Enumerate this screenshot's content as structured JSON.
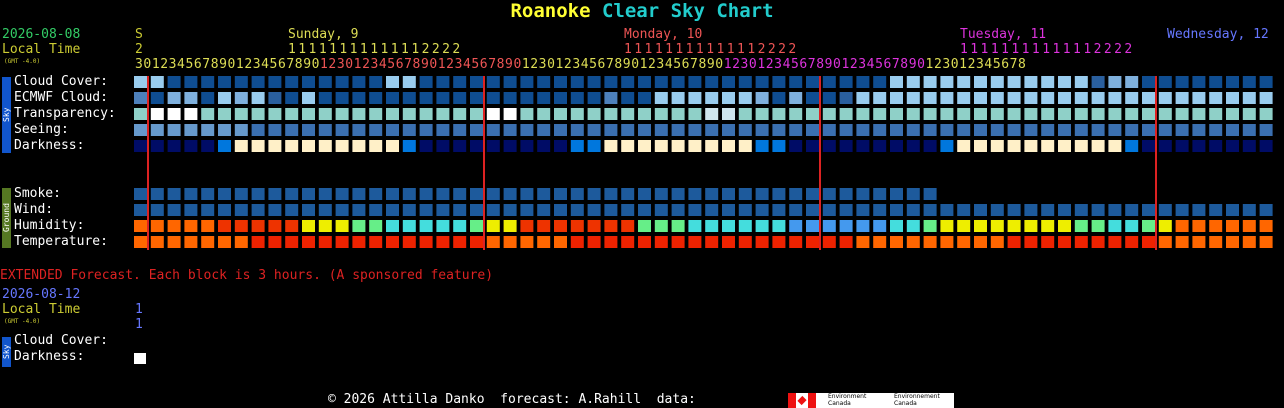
{
  "title": {
    "location": "Roanoke",
    "chart_name": "Clear Sky Chart"
  },
  "header": {
    "date": "2026-08-08",
    "local_time_label": "Local Time",
    "gmt_offset": "(GMT -4.0)",
    "first_day_letter": "S",
    "first_hour_digit": "2",
    "days": [
      {
        "label": "Sunday, 9",
        "tens": "11111111111112222",
        "color": "#dddd55"
      },
      {
        "label": "Monday, 10",
        "tens": "11111111111112222",
        "color": "#ee5555"
      },
      {
        "label": "Tuesday, 11",
        "tens": "11111111111112222",
        "color": "#dd33dd"
      },
      {
        "label": "Wednesday, 12",
        "tens": "",
        "color": "#6677ff"
      }
    ],
    "hour_digits": "3012345678901234567890123012345678901234567890123012345678901234567890123012345678901234567890123012345678"
  },
  "sky_group_label": "Sky",
  "ground_group_label": "Ground",
  "rows": {
    "cloud_cover": "Cloud Cover:",
    "ecmwf_cloud": "ECMWF Cloud:",
    "transparency": "Transparency:",
    "seeing": "Seeing:",
    "darkness": "Darkness:",
    "smoke": "Smoke:",
    "wind": "Wind:",
    "humidity": "Humidity:",
    "temperature": "Temperature:"
  },
  "extended": {
    "notice": "EXTENDED Forecast. Each block is 3 hours. (A sponsored feature)",
    "date": "2026-08-12",
    "local_time_label": "Local Time",
    "gmt_offset": "(GMT -4.0)",
    "hour_line1": "1",
    "hour_line2": "1",
    "cloud_cover": "Cloud Cover:",
    "darkness": "Darkness:",
    "sky_label": "Sky"
  },
  "footer": {
    "copyright": "© 2026 Attilla Danko  forecast: A.Rahill  data:",
    "env_en_1": "Environment",
    "env_en_2": "Canada",
    "env_fr_1": "Environnement",
    "env_fr_2": "Canada"
  },
  "colors": {
    "midnight_line": "#dd2222",
    "clear_dark": "#0f4d91",
    "light_blue": "#6699cc",
    "cloud_light": "#99ccee",
    "white": "#ffffff",
    "night": "#000c66",
    "twilight": "#0077dd",
    "day": "#ffffff",
    "temp_orange": "#ff6600"
  },
  "grid": {
    "blocks": 68,
    "midnight_indices": [
      1,
      21,
      41,
      61
    ],
    "cloud_cover": "7772222222222222222222222222777222222222222222222222222222222222222222222222222222222277777777777777777777773366662222222222222222",
    "ecmwf": "42766627767736272222272222222222222222222220422277777777736226222337777777777777777777777777777777777777777",
    "transparency": "455544444444444444444455444444444444334444444444444444444444444444444444",
    "seeing": "7777777766666666666666666666666666666666666666666666666666666666666666666666666",
    "darkness": "nnnnnnttdddddddddddddttnnnnnnnnnnnnttdddddddddddddttnnnnnnnnnnnnttdddddddddddddttnnnnnnnnnnn",
    "smoke_blocks": 48,
    "wind": "2222222222222222222222222222222222222222222222222222222222222222222",
    "humidity": "oooorrrrryyyggcccccgyyrrrrrrrgggcccccbbbbbbccgyyyyyyyyggccgyoooooo",
    "temperature": "oooooorrrrrrrrrrrrrrooooorrrrrrrrrrrrrrrrrooooooooorrrrrrrrrooooooo"
  }
}
